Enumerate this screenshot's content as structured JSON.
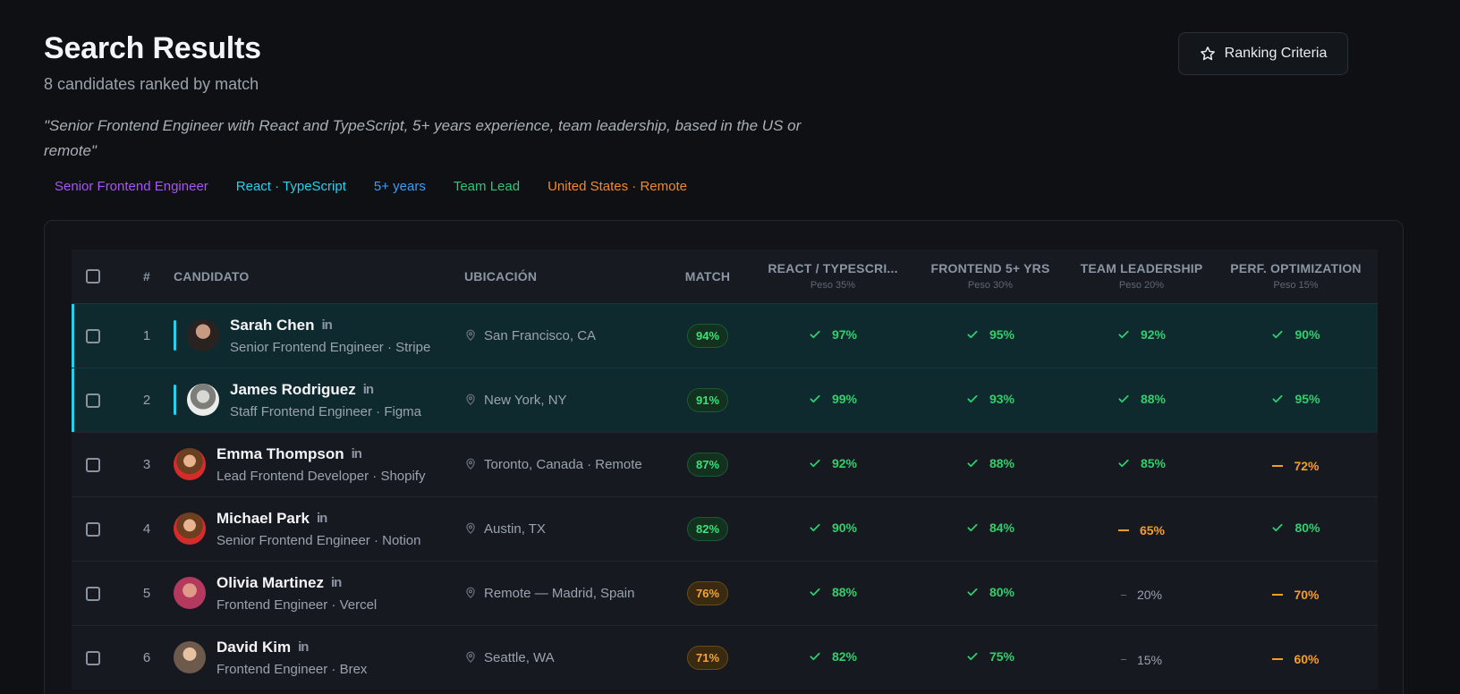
{
  "header": {
    "title": "Search Results",
    "subtitle": "8 candidates ranked by match",
    "query": "\"Senior Frontend Engineer with React and TypeScript, 5+ years experience, team leadership, based in the US or remote\"",
    "ranking_button": "Ranking Criteria"
  },
  "tags": [
    "Senior Frontend Engineer",
    "React · TypeScript",
    "5+ years",
    "Team Lead",
    "United States · Remote"
  ],
  "colors": {
    "accent": "#22d3ee",
    "good": "#2fd06d",
    "mid": "#f59e22",
    "purple": "#a855f7",
    "blue": "#3b9ef5",
    "teamlead": "#34c27a",
    "orange": "#f08a2a"
  },
  "table": {
    "columns": {
      "num": "#",
      "candidate": "Candidato",
      "location": "Ubicación",
      "match": "Match",
      "c1": "React / TypeScri...",
      "c1_peso": "Peso 35%",
      "c2": "Frontend 5+ Yrs",
      "c2_peso": "Peso 30%",
      "c3": "Team Leadership",
      "c3_peso": "Peso 20%",
      "c4": "Perf. Optimization",
      "c4_peso": "Peso 15%"
    },
    "rows": [
      {
        "rank": "1",
        "name": "Sarah Chen",
        "linkedin": "in",
        "role": "Senior Frontend Engineer · Stripe",
        "location": "San Francisco, CA",
        "match": "94%",
        "s1": "97%",
        "s2": "95%",
        "s3": "92%",
        "s4": "90%"
      },
      {
        "rank": "2",
        "name": "James Rodriguez",
        "linkedin": "in",
        "role": "Staff Frontend Engineer · Figma",
        "location": "New York, NY",
        "match": "91%",
        "s1": "99%",
        "s2": "93%",
        "s3": "88%",
        "s4": "95%"
      },
      {
        "rank": "3",
        "name": "Emma Thompson",
        "linkedin": "in",
        "role": "Lead Frontend Developer · Shopify",
        "location": "Toronto, Canada · Remote",
        "match": "87%",
        "s1": "92%",
        "s2": "88%",
        "s3": "85%",
        "s4": "72%"
      },
      {
        "rank": "4",
        "name": "Michael Park",
        "linkedin": "in",
        "role": "Senior Frontend Engineer · Notion",
        "location": "Austin, TX",
        "match": "82%",
        "s1": "90%",
        "s2": "84%",
        "s3": "65%",
        "s4": "80%"
      },
      {
        "rank": "5",
        "name": "Olivia Martinez",
        "linkedin": "in",
        "role": "Frontend Engineer · Vercel",
        "location": "Remote — Madrid, Spain",
        "match": "76%",
        "s1": "88%",
        "s2": "80%",
        "s3": "20%",
        "s4": "70%"
      },
      {
        "rank": "6",
        "name": "David Kim",
        "linkedin": "in",
        "role": "Frontend Engineer · Brex",
        "location": "Seattle, WA",
        "match": "71%",
        "s1": "82%",
        "s2": "75%",
        "s3": "15%",
        "s4": "60%"
      }
    ]
  }
}
